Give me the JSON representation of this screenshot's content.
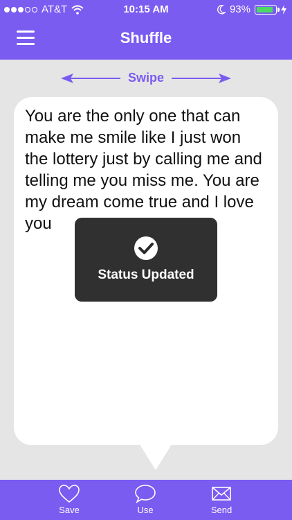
{
  "status_bar": {
    "carrier": "AT&T",
    "time": "10:15 AM",
    "battery_percent": "93%",
    "battery_level": 0.93
  },
  "nav": {
    "title": "Shuffle",
    "menu_icon": "hamburger-menu-icon"
  },
  "swipe_hint": {
    "label": "Swipe"
  },
  "message": {
    "text": "You are the only one that can make me smile like I just won the lottery just by calling me and telling me you miss me. You are my dream come true and I love you"
  },
  "toast": {
    "icon": "checkmark-icon",
    "text": "Status Updated"
  },
  "tabbar": {
    "items": [
      {
        "label": "Save",
        "icon": "heart-icon"
      },
      {
        "label": "Use",
        "icon": "speech-bubble-icon"
      },
      {
        "label": "Send",
        "icon": "envelope-icon"
      }
    ]
  },
  "colors": {
    "accent": "#7a5cf0",
    "battery": "#4cd964",
    "background": "#e5e5e5"
  }
}
